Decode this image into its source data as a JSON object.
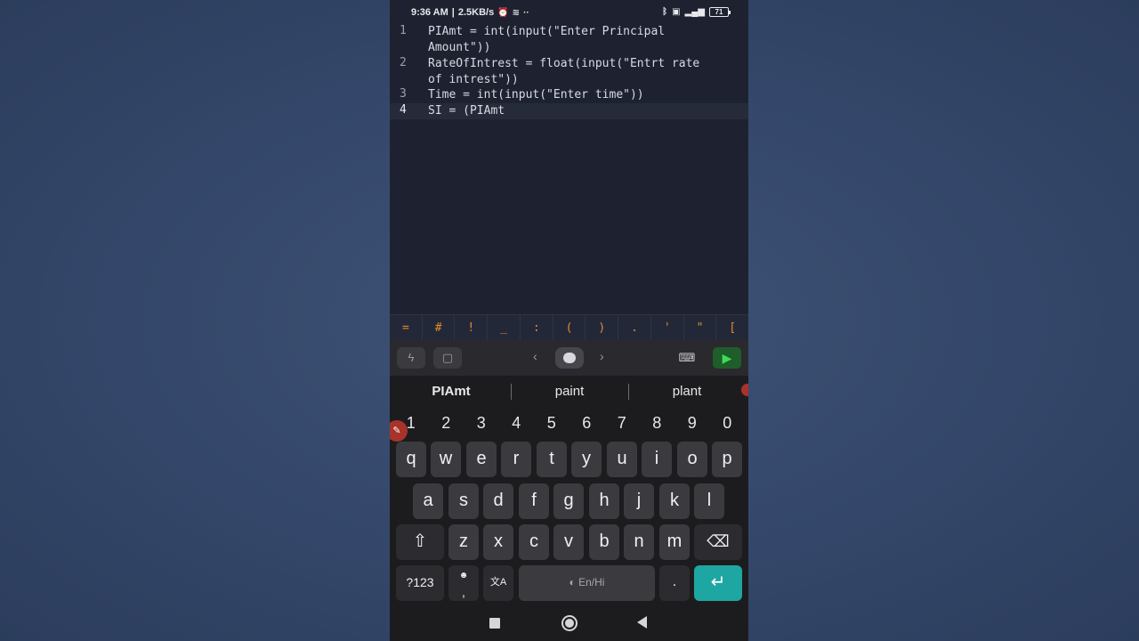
{
  "status_bar": {
    "time": "9:36 AM",
    "network_speed": "2.5KB/s",
    "alarm_icon": "alarm-icon",
    "battery_level": "71"
  },
  "editor": {
    "lines": [
      {
        "num": "1",
        "text_1": "PIAmt = int(input(\"Enter Principal",
        "text_2": "Amount\"))"
      },
      {
        "num": "2",
        "text_1": "RateOfIntrest = float(input(\"Entrt rate",
        "text_2": "of intrest\"))"
      },
      {
        "num": "3",
        "text_1": "Time = int(input(\"Enter time\"))"
      },
      {
        "num": "4",
        "text_1": "SI = (PIAmt"
      }
    ]
  },
  "symbol_bar": [
    "=",
    "#",
    "!",
    "_",
    ":",
    "(",
    ")",
    ".",
    "'",
    "\"",
    "["
  ],
  "toolbar": {
    "flash_icon": "flash-icon",
    "clipboard_icon": "clipboard-icon",
    "prev_label": "‹",
    "next_label": "›",
    "keyboard_icon": "keyboard-icon",
    "run_label": "▶"
  },
  "keyboard": {
    "suggestions": [
      "PIAmt",
      "paint",
      "plant"
    ],
    "numbers": [
      "1",
      "2",
      "3",
      "4",
      "5",
      "6",
      "7",
      "8",
      "9",
      "0"
    ],
    "row1": [
      "q",
      "w",
      "e",
      "r",
      "t",
      "y",
      "u",
      "i",
      "o",
      "p"
    ],
    "row2": [
      "a",
      "s",
      "d",
      "f",
      "g",
      "h",
      "j",
      "k",
      "l"
    ],
    "row3": [
      "z",
      "x",
      "c",
      "v",
      "b",
      "n",
      "m"
    ],
    "shift_label": "⇧",
    "backspace_label": "⌫",
    "symbols_label": "?123",
    "comma_label": ",",
    "emoji_label": "☻",
    "translate_label": "文A",
    "space_label": "En/Hi",
    "period_label": ".",
    "enter_label": "↵"
  },
  "colors": {
    "background": "#34476a",
    "editor_bg": "#1e2230",
    "symbol_color": "#e38a2e",
    "run_button": "#1f5d2a",
    "enter_key": "#1ea6a2"
  }
}
